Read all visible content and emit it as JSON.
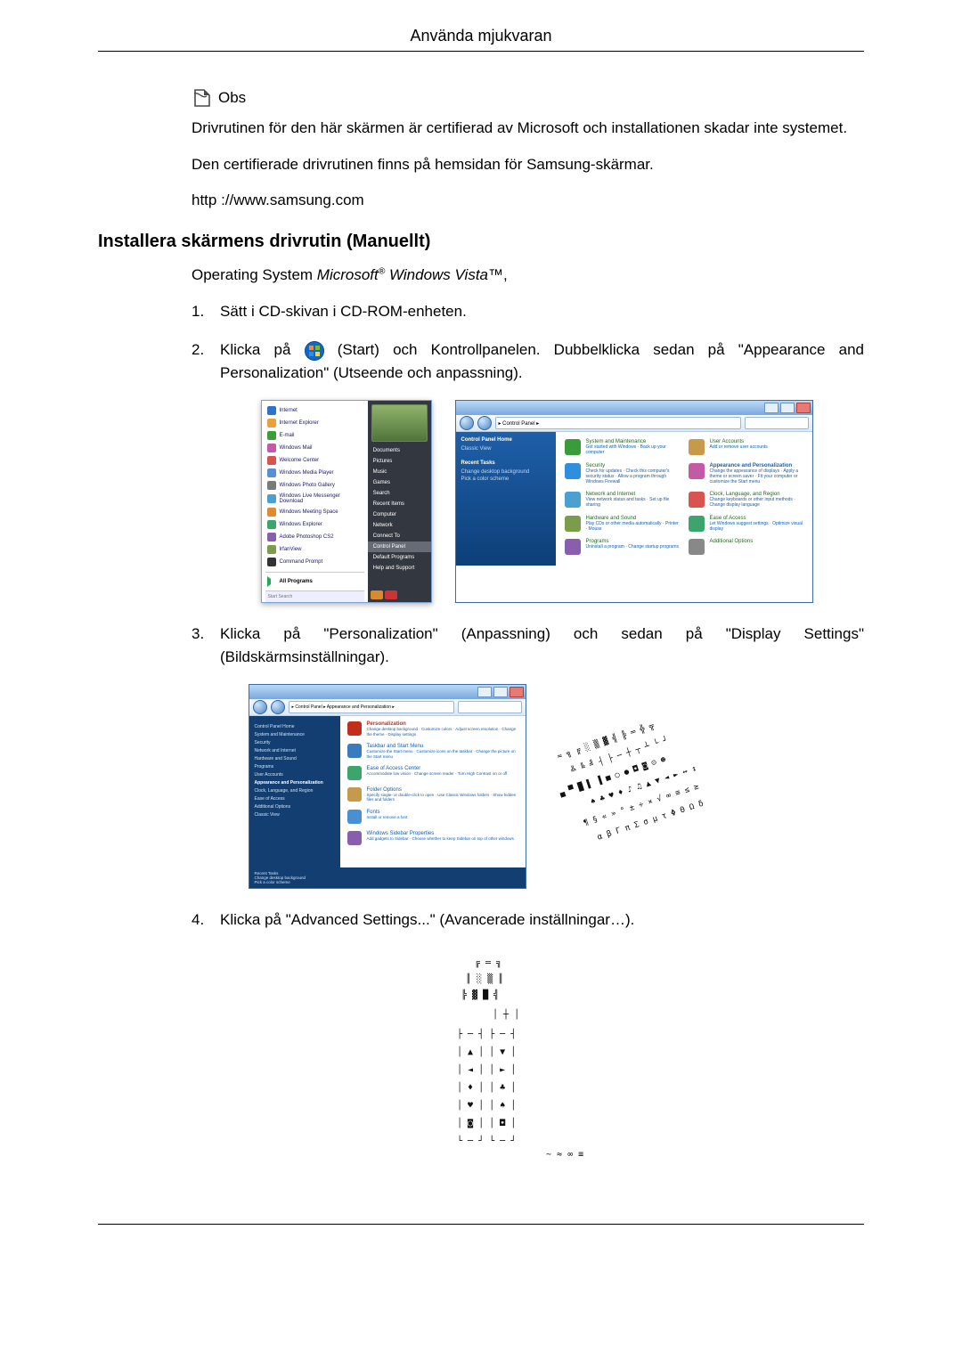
{
  "header": {
    "title": "Använda mjukvaran"
  },
  "note": {
    "label": "Obs",
    "p1": "Drivrutinen för den här skärmen är certifierad av Microsoft och installationen skadar inte systemet.",
    "p2": "Den certifierade drivrutinen finns på hemsidan för Samsung-skärmar.",
    "p3": "http ://www.samsung.com"
  },
  "section": {
    "heading": "Installera skärmens drivrutin (Manuellt)",
    "os_prefix": "Operating System ",
    "os_brand": "Microsoft",
    "os_reg": "®",
    "os_rest": " Windows Vista™",
    "os_comma": ","
  },
  "steps": {
    "s1": {
      "num": "1.",
      "text": "Sätt i CD-skivan i CD-ROM-enheten."
    },
    "s2": {
      "num": "2.",
      "pre": "Klicka på ",
      "post": " (Start) och Kontrollpanelen. Dubbelklicka sedan på \"Appearance and Personalization\" (Utseende och anpassning)."
    },
    "s3": {
      "num": "3.",
      "text": "Klicka på \"Personalization\" (Anpassning) och sedan på \"Display Settings\" (Bildskärmsinställningar)."
    },
    "s4": {
      "num": "4.",
      "text": "Klicka på \"Advanced Settings...\" (Avancerade inställningar…)."
    }
  },
  "start_menu": {
    "left": [
      "Internet",
      "Internet Explorer",
      "E-mail",
      "Windows Mail",
      "Welcome Center",
      "Windows Media Player",
      "Windows Photo Gallery",
      "Windows Live Messenger Download",
      "Windows Meeting Space",
      "Windows Explorer",
      "Adobe Photoshop CS2",
      "IrfanView",
      "Command Prompt"
    ],
    "all_programs": "All Programs",
    "search_placeholder": "Start Search",
    "right": [
      "Documents",
      "Pictures",
      "Music",
      "Games",
      "Search",
      "Recent Items",
      "Computer",
      "Network",
      "Connect To",
      "Control Panel",
      "Default Programs",
      "Help and Support"
    ],
    "right_highlight": "Control Panel"
  },
  "control_panel": {
    "crumb": "▸ Control Panel ▸",
    "side_head": "Control Panel Home",
    "side_link": "Classic View",
    "recent_label": "Recent Tasks",
    "recent1": "Change desktop background",
    "recent2": "Pick a color scheme",
    "categories": [
      {
        "title": "System and Maintenance",
        "sub": "Get started with Windows · Back up your computer",
        "color": "#3a9b3a"
      },
      {
        "title": "User Accounts",
        "sub": "Add or remove user accounts",
        "color": "#3a9b3a"
      },
      {
        "title": "Security",
        "sub": "Check for updates · Check this computer's security status · Allow a program through Windows Firewall",
        "color": "#3a9b3a"
      },
      {
        "title": "Appearance and Personalization",
        "sub": "Change the appearance of displays · Apply a theme or screen saver · Fit your computer or customize the Start menu",
        "hl": true,
        "color": "#1560b8"
      },
      {
        "title": "Network and Internet",
        "sub": "View network status and tasks · Set up file sharing",
        "color": "#3a9b3a"
      },
      {
        "title": "Clock, Language, and Region",
        "sub": "Change keyboards or other input methods · Change display language",
        "color": "#3a9b3a"
      },
      {
        "title": "Hardware and Sound",
        "sub": "Play CDs or other media automatically · Printer · Mouse",
        "color": "#3a9b3a"
      },
      {
        "title": "Ease of Access",
        "sub": "Let Windows suggest settings · Optimize visual display",
        "color": "#3a9b3a"
      },
      {
        "title": "Programs",
        "sub": "Uninstall a program · Change startup programs",
        "color": "#3a9b3a"
      },
      {
        "title": "Additional Options",
        "sub": "",
        "color": "#3a9b3a"
      }
    ]
  },
  "personalization": {
    "crumb": "▸ Control Panel ▸ Appearance and Personalization ▸",
    "side": [
      "Control Panel Home",
      "System and Maintenance",
      "Security",
      "Network and Internet",
      "Hardware and Sound",
      "Programs",
      "User Accounts",
      "Appearance and Personalization",
      "Clock, Language, and Region",
      "Ease of Access",
      "Additional Options",
      "Classic View"
    ],
    "side_hl": "Appearance and Personalization",
    "items": [
      {
        "title": "Personalization",
        "desc": "Change desktop background · Customize colors · Adjust screen resolution · Change the theme · Display settings",
        "hl": true
      },
      {
        "title": "Taskbar and Start Menu",
        "desc": "Customize the Start menu · Customize icons on the taskbar · Change the picture on the Start menu"
      },
      {
        "title": "Ease of Access Center",
        "desc": "Accommodate low vision · Change screen reader · Turn High Contrast on or off"
      },
      {
        "title": "Folder Options",
        "desc": "Specify single- or double-click to open · Use Classic Windows folders · Show hidden files and folders"
      },
      {
        "title": "Fonts",
        "desc": "Install or remove a font"
      },
      {
        "title": "Windows Sidebar Properties",
        "desc": "Add gadgets to Sidebar · Choose whether to keep Sidebar on top of other windows"
      }
    ],
    "recent_label": "Recent Tasks",
    "recent1": "Change desktop background",
    "recent2": "Pick a color scheme"
  }
}
